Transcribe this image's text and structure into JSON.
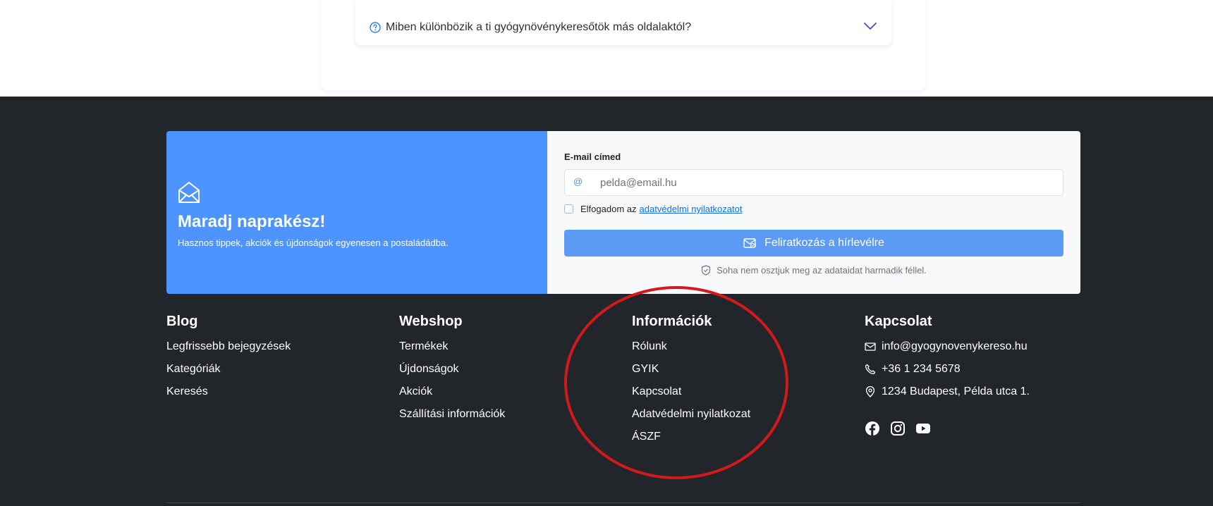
{
  "faq": {
    "question": "Miben különbözik a ti gyógynövénykeresőtök más oldalaktól?",
    "question_icon": "question-circle-icon",
    "toggle_icon": "chevron-down-icon"
  },
  "newsletter": {
    "title": "Maradj naprakész!",
    "subtitle": "Hasznos tippek, akciók és újdonságok egyenesen a postaládádba.",
    "icon": "envelope-open-icon",
    "email_label": "E-mail címed",
    "email_prefix": "@",
    "email_placeholder": "pelda@email.hu",
    "consent_text": "Elfogadom az",
    "consent_link": "adatvédelmi nyilatkozatot",
    "submit_label": "Feliratkozás a hírlevélre",
    "privacy_note": "Soha nem osztjuk meg az adataidat harmadik féllel.",
    "accent_color": "#4d94ff"
  },
  "footer": {
    "blog": {
      "title": "Blog",
      "items": [
        "Legfrissebb bejegyzések",
        "Kategóriák",
        "Keresés"
      ]
    },
    "webshop": {
      "title": "Webshop",
      "items": [
        "Termékek",
        "Újdonságok",
        "Akciók",
        "Szállítási információk"
      ]
    },
    "info": {
      "title": "Információk",
      "items": [
        "Rólunk",
        "GYIK",
        "Kapcsolat",
        "Adatvédelmi nyilatkozat",
        "ÁSZF"
      ]
    },
    "contact": {
      "title": "Kapcsolat",
      "email": "info@gyogynovenykereso.hu",
      "phone": "+36 1 234 5678",
      "address": "1234 Budapest, Példa utca 1.",
      "social": [
        "facebook-icon",
        "instagram-icon",
        "youtube-icon"
      ]
    },
    "background": "#222529",
    "highlight_color": "#d2191c"
  }
}
